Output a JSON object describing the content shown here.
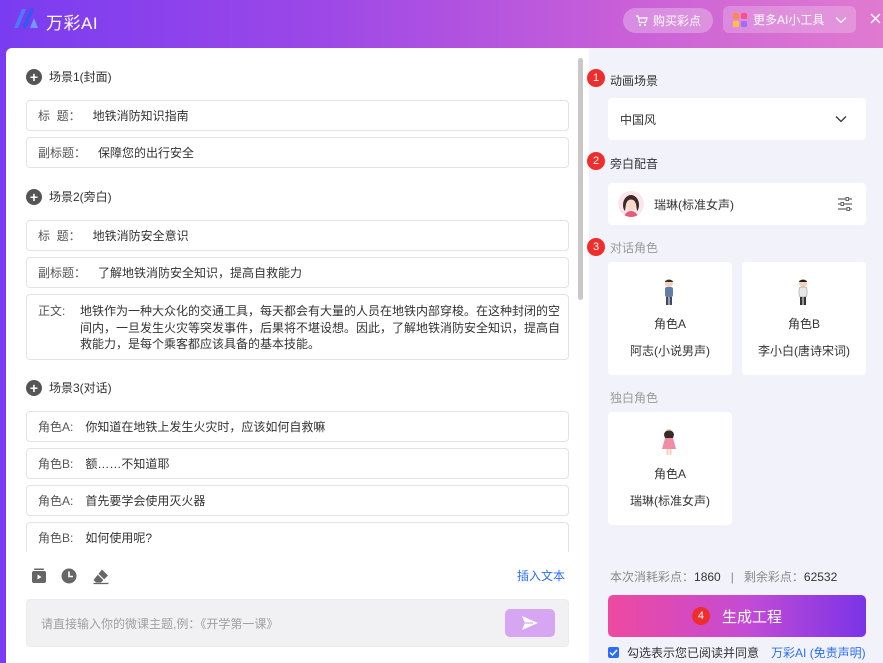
{
  "app": {
    "title": "万彩AI"
  },
  "header": {
    "buy_label": "购买彩点",
    "more_tools_label": "更多AI小工具"
  },
  "scenes": [
    {
      "title": "场景1(封面)",
      "fields": [
        {
          "key": "标  题：",
          "value": "地铁消防知识指南"
        },
        {
          "key": "副标题：",
          "value": "保障您的出行安全"
        }
      ]
    },
    {
      "title": "场景2(旁白)",
      "fields": [
        {
          "key": "标  题：",
          "value": "地铁消防安全意识"
        },
        {
          "key": "副标题：",
          "value": "了解地铁消防安全知识，提高自救能力"
        }
      ],
      "body_key": "正文:",
      "body_value": "地铁作为一种大众化的交通工具，每天都会有大量的人员在地铁内部穿梭。在这种封闭的空间内，一旦发生火灾等突发事件，后果将不堪设想。因此，了解地铁消防安全知识，提高自救能力，是每个乘客都应该具备的基本技能。"
    },
    {
      "title": "场景3(对话)",
      "lines": [
        {
          "role": "角色A:",
          "text": "你知道在地铁上发生火灾时，应该如何自救嘛"
        },
        {
          "role": "角色B:",
          "text": "额……不知道耶"
        },
        {
          "role": "角色A:",
          "text": "首先要学会使用灭火器"
        },
        {
          "role": "角色B:",
          "text": "如何使用呢?"
        }
      ]
    }
  ],
  "editor": {
    "insert_text_label": "插入文本",
    "prompt_placeholder": "请直接输入你的微课主题,例：《开学第一课》"
  },
  "settings": {
    "step1": {
      "num": "1",
      "label": "动画场景",
      "value": "中国风"
    },
    "step2": {
      "num": "2",
      "label": "旁白配音",
      "value": "瑞琳(标准女声)"
    },
    "step3": {
      "num": "3",
      "label": "对话角色"
    },
    "dialog_roles": [
      {
        "name": "角色A",
        "voice": "阿志(小说男声)"
      },
      {
        "name": "角色B",
        "voice": "李小白(唐诗宋词)"
      }
    ],
    "solo_label": "独白角色",
    "solo_roles": [
      {
        "name": "角色A",
        "voice": "瑞琳(标准女声)"
      }
    ]
  },
  "stats": {
    "consume_label": "本次消耗彩点：",
    "consume_value": "1860",
    "sep": "|",
    "remain_label": "剩余彩点：",
    "remain_value": "62532"
  },
  "generate": {
    "num": "4",
    "label": "生成工程"
  },
  "agreement": {
    "text": "勾选表示您已阅读并同意",
    "link": "万彩AI (免责声明)"
  },
  "colors": {
    "accent": "#2a6ef5",
    "badge": "#f02d2d",
    "primary_gradient_start": "#ee4aa0",
    "primary_gradient_end": "#7a34e6"
  }
}
